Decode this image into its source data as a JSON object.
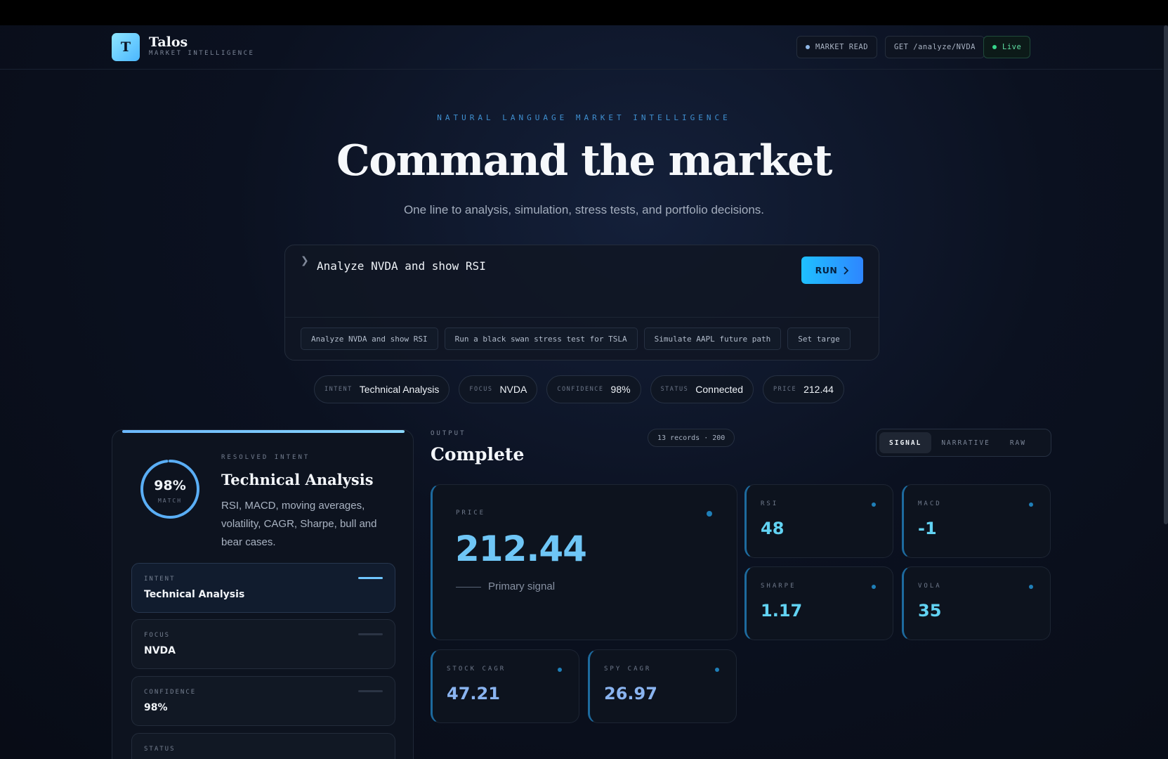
{
  "header": {
    "logo_letter": "T",
    "brand_name": "Talos",
    "brand_tagline": "MARKET INTELLIGENCE",
    "chips": {
      "mode": "MARKET READ",
      "endpoint": "GET /analyze/NVDA",
      "live": "Live"
    }
  },
  "hero": {
    "eyebrow": "NATURAL LANGUAGE MARKET INTELLIGENCE",
    "title": "Command the market",
    "subtitle": "One line to analysis, simulation, stress tests, and portfolio decisions."
  },
  "command": {
    "prompt_glyph": "❯",
    "value": "Analyze NVDA and show RSI",
    "run_label": "RUN",
    "suggestions": [
      "Analyze NVDA and show RSI",
      "Run a black swan stress test for TSLA",
      "Simulate AAPL future path",
      "Set targe"
    ]
  },
  "status": {
    "intent_label": "INTENT",
    "intent_value": "Technical Analysis",
    "focus_label": "FOCUS",
    "focus_value": "NVDA",
    "confidence_label": "CONFIDENCE",
    "confidence_value": "98%",
    "status_label": "STATUS",
    "status_value": "Connected",
    "price_label": "PRICE",
    "price_value": "212.44"
  },
  "resolved": {
    "match_pct": "98%",
    "match_fraction": 0.98,
    "match_label": "MATCH",
    "eyebrow": "RESOLVED INTENT",
    "title": "Technical Analysis",
    "description": "RSI, MACD, moving averages, volatility, CAGR, Sharpe, bull and bear cases.",
    "cards": [
      {
        "label": "INTENT",
        "value": "Technical Analysis"
      },
      {
        "label": "FOCUS",
        "value": "NVDA"
      },
      {
        "label": "CONFIDENCE",
        "value": "98%"
      },
      {
        "label": "STATUS",
        "value": ""
      }
    ]
  },
  "output": {
    "eyebrow": "OUTPUT",
    "title": "Complete",
    "records": "13 records · 200",
    "tabs": [
      "SIGNAL",
      "NARRATIVE",
      "RAW"
    ],
    "price": {
      "label": "PRICE",
      "value": "212.44",
      "sub": "Primary signal"
    },
    "metrics": {
      "rsi": {
        "label": "RSI",
        "value": "48"
      },
      "macd": {
        "label": "MACD",
        "value": "-1"
      },
      "sharpe": {
        "label": "SHARPE",
        "value": "1.17"
      },
      "vola": {
        "label": "VOLA",
        "value": "35"
      },
      "stock_cagr": {
        "label": "STOCK CAGR",
        "value": "47.21"
      },
      "spy_cagr": {
        "label": "SPY CAGR",
        "value": "26.97"
      }
    }
  },
  "colors": {
    "accent": "#1fc0ff",
    "live": "#36d48a",
    "metric_value": "#62d3f3"
  }
}
